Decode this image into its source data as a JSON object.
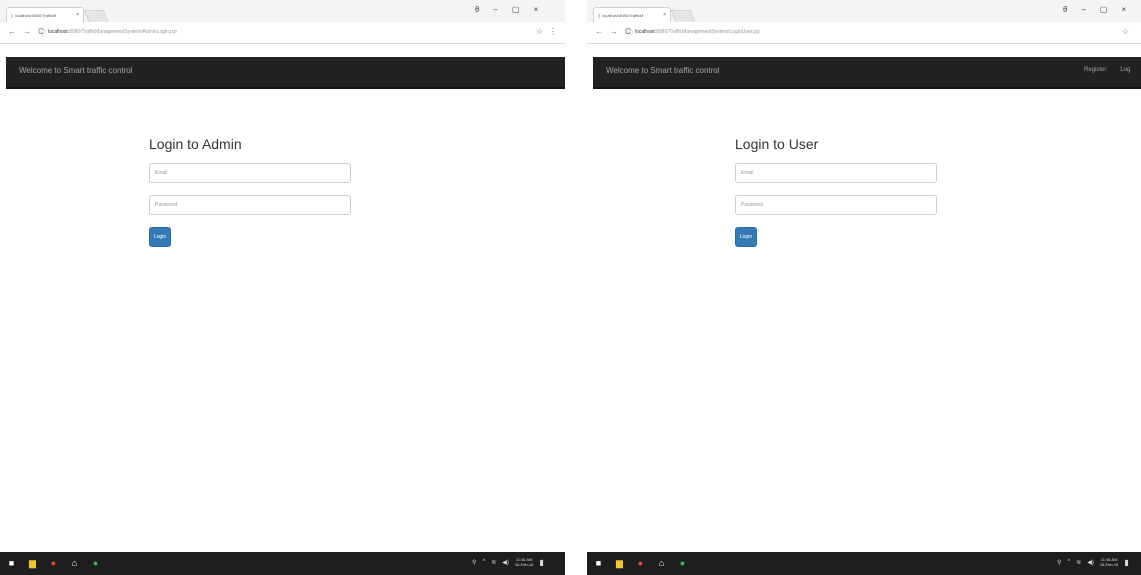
{
  "left": {
    "tab_title": "localhost:8080/TrafficM",
    "url_host": "localhost",
    "url_rest": ":8080/TrafficManagementSystem/AdminLogin.jsp",
    "brand": "Welcome to Smart traffic control",
    "form_title": "Login to Admin",
    "email_placeholder": "Email",
    "password_placeholder": "Password",
    "login_label": "Login",
    "clock_time": "11:46 AM",
    "clock_date": "16-Feb-16"
  },
  "right": {
    "tab_title": "localhost:8080/TrafficM",
    "url_host": "localhost",
    "url_rest": ":8080/TrafficManagementSystem/LoginUser.jsp",
    "brand": "Welcome to Smart traffic control",
    "nav_register": "Register",
    "nav_login": "Log",
    "form_title": "Login to User",
    "email_placeholder": "Email",
    "password_placeholder": "Password",
    "login_label": "Login",
    "clock_time": "11:46 AM",
    "clock_date": "16-Feb-16"
  },
  "icons": {
    "tab_close": "×",
    "back": "←",
    "forward": "→",
    "reload": "C",
    "info": "ⓘ",
    "star": "☆",
    "menu": "⋮",
    "profile": "θ",
    "minimize": "–",
    "restore": "▢",
    "close": "×"
  },
  "colors": {
    "navbar": "#222222",
    "brand_text": "#a5a5a5",
    "primary_button": "#337ab7",
    "taskbar": "#1e1e1e"
  }
}
